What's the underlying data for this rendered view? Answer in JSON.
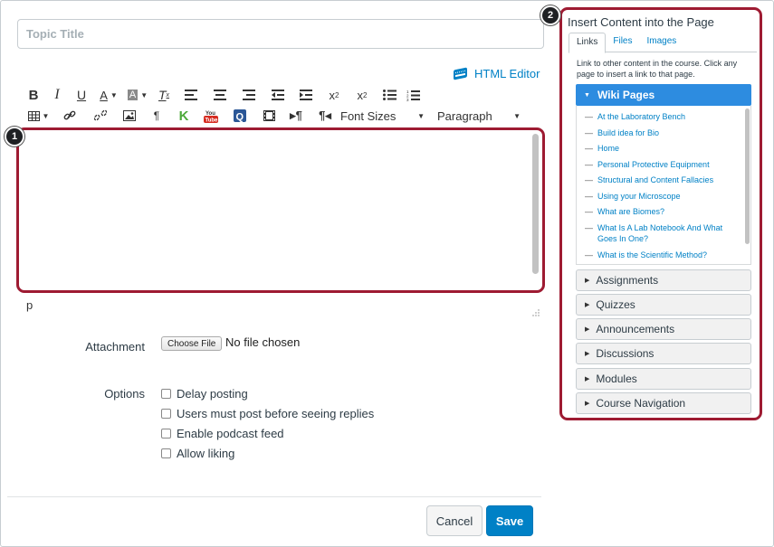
{
  "topic": {
    "title_placeholder": "Topic Title"
  },
  "editor": {
    "html_editor_label": "HTML Editor",
    "font_sizes_label": "Font Sizes",
    "paragraph_label": "Paragraph",
    "path": "p",
    "badge": "1"
  },
  "attachment": {
    "label": "Attachment",
    "choose_file": "Choose File",
    "no_file": "No file chosen"
  },
  "options": {
    "label": "Options",
    "items": [
      "Delay posting",
      "Users must post before seeing replies",
      "Enable podcast feed",
      "Allow liking"
    ]
  },
  "footer": {
    "cancel": "Cancel",
    "save": "Save"
  },
  "sidebar": {
    "badge": "2",
    "title": "Insert Content into the Page",
    "tabs": [
      "Links",
      "Files",
      "Images"
    ],
    "description": "Link to other content in the course. Click any page to insert a link to that page.",
    "wiki_header": "Wiki Pages",
    "wiki_pages": [
      "At the Laboratory Bench",
      "Build idea for Bio",
      "Home",
      "Personal Protective Equipment",
      "Structural and Content Fallacies",
      "Using your Microscope",
      "What are Biomes?",
      "What Is A Lab Notebook And What Goes In One?",
      "What is the Scientific Method?"
    ],
    "sections": [
      "Assignments",
      "Quizzes",
      "Announcements",
      "Discussions",
      "Modules",
      "Course Navigation"
    ]
  },
  "colors": {
    "highlight": "#9e1b32",
    "accent": "#0081c6",
    "wiki_header": "#2d8ce0"
  }
}
